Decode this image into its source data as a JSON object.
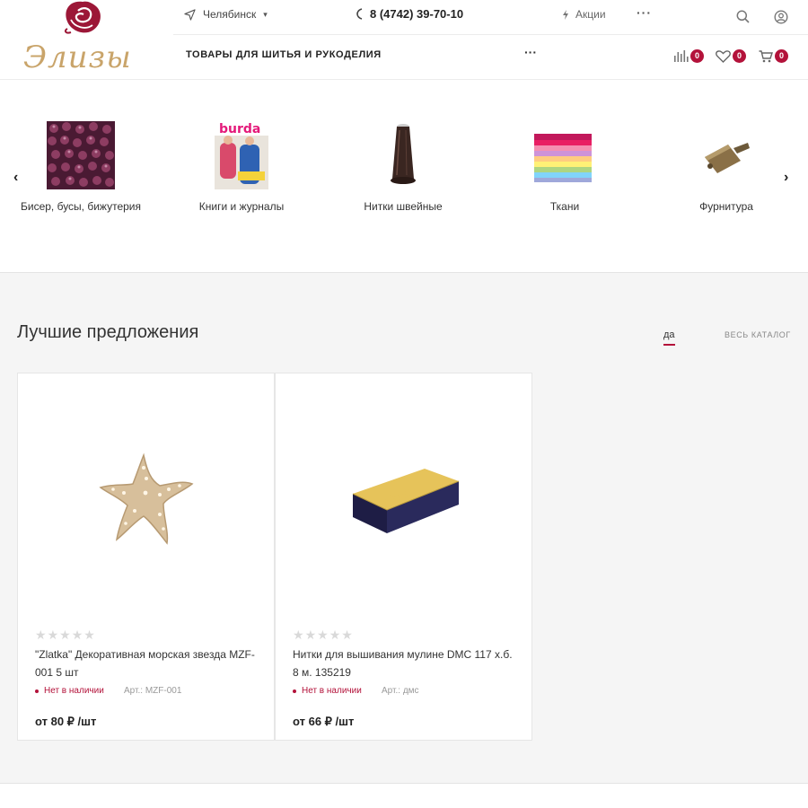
{
  "header": {
    "logo_text": "Элизы",
    "city": "Челябинск",
    "phone": "8 (4742) 39-70-10",
    "promo_label": "Акции",
    "top_more": "···",
    "catalog_title": "ТОВАРЫ ДЛЯ ШИТЬЯ И РУКОДЕЛИЯ",
    "menu_more": "···",
    "compare_count": "0",
    "favorites_count": "0",
    "cart_count": "0",
    "accent_color": "#b3123a"
  },
  "categories": {
    "prev_arrow": "‹",
    "next_arrow": "›",
    "items": [
      {
        "label": "Бисер, бусы, бижутерия"
      },
      {
        "label": "Книги и журналы"
      },
      {
        "label": "Нитки швейные"
      },
      {
        "label": "Ткани"
      },
      {
        "label": "Фурнитура"
      }
    ]
  },
  "offers": {
    "title": "Лучшие предложения",
    "tab_active": "да",
    "tab_all": "ВЕСЬ КАТАЛОГ",
    "products": [
      {
        "name": "\"Zlatka\" Декоративная морская звезда MZF-001 5 шт",
        "stock": "Нет в наличии",
        "article": "Арт.: MZF-001",
        "price": "от 80 ₽ /шт",
        "rating": 0
      },
      {
        "name": "Нитки для вышивания мулине DMC 117 х.б. 8 м. 135219",
        "stock": "Нет в наличии",
        "article": "Арт.: дмс",
        "price": "от 66 ₽ /шт",
        "rating": 0
      }
    ]
  }
}
